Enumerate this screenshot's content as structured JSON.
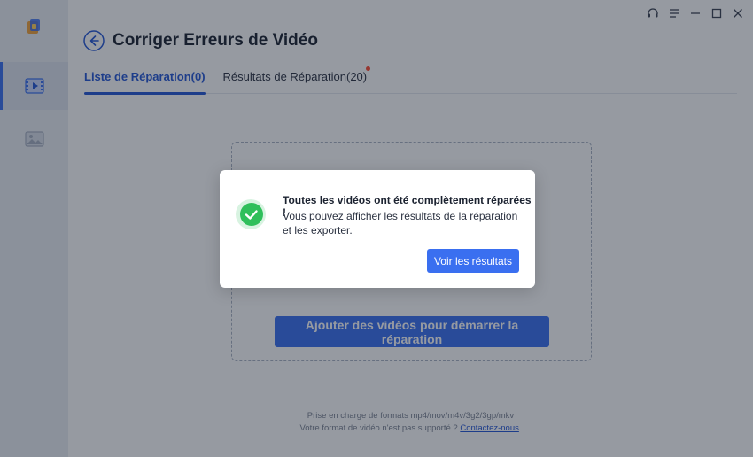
{
  "header": {
    "title": "Corriger Erreurs de Vidéo"
  },
  "tabs": [
    {
      "label": "Liste de Réparation(0)",
      "active": true
    },
    {
      "label": "Résultats de Réparation(20)",
      "active": false,
      "has_notification_dot": true
    }
  ],
  "sidebar": {
    "items": [
      {
        "icon": "video-repair-icon",
        "active": true
      },
      {
        "icon": "photo-repair-icon",
        "active": false
      }
    ]
  },
  "window_controls": [
    "headset-icon",
    "menu-icon",
    "minimize-icon",
    "maximize-icon",
    "close-icon"
  ],
  "main": {
    "add_button_label": "Ajouter des vidéos pour démarrer la réparation",
    "formats_text": "Prise en charge de formats mp4/mov/m4v/3g2/3gp/mkv",
    "unsupported_text": "Votre format de vidéo n'est pas supporté ? ",
    "contact_link": "Contactez-nous",
    "contact_suffix": "."
  },
  "modal": {
    "title": "Toutes les vidéos ont été complètement réparées !",
    "message": "Vous pouvez afficher les résultats de la réparation et les exporter.",
    "button_label": "Voir les résultats"
  },
  "colors": {
    "accent": "#3a6ff0",
    "tab_active": "#2456d6",
    "success": "#2fbf5b",
    "notification": "#ff4b33"
  }
}
